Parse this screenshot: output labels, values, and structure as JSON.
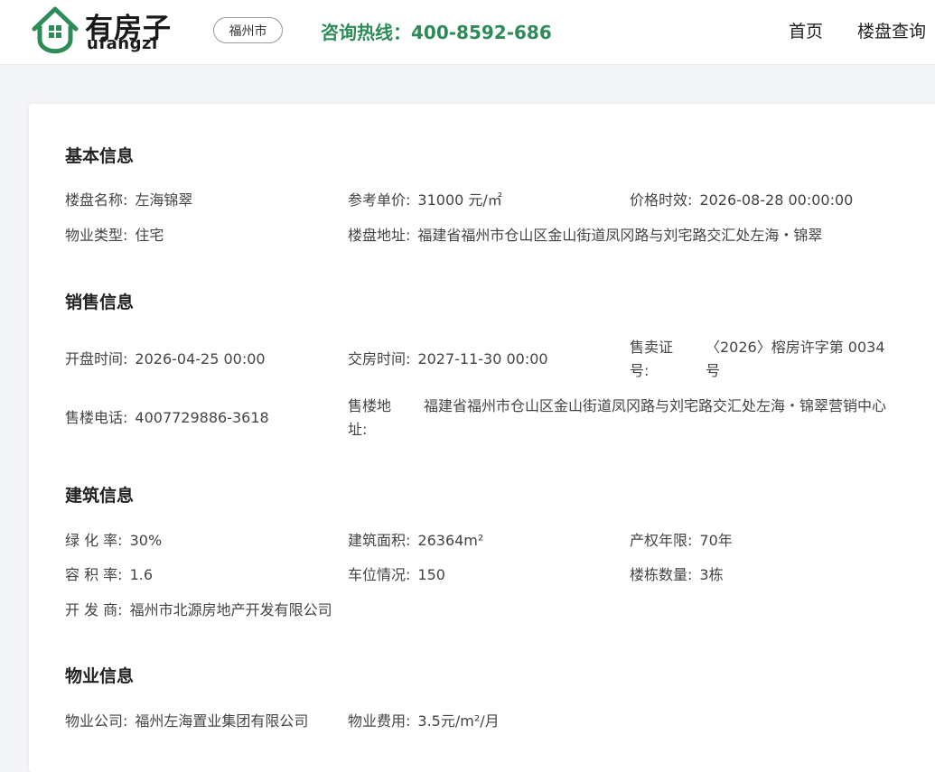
{
  "header": {
    "logo_cn": "有房子",
    "logo_en": "ufangzi",
    "city": "福州市",
    "hotline": "咨询热线：400-8592-686",
    "nav": [
      "首页",
      "楼盘查询"
    ]
  },
  "colors": {
    "brand_green": "#2e8b57",
    "text": "#444444"
  },
  "basic": {
    "title": "基本信息",
    "name_label": "楼盘名称:",
    "name": "左海锦翠",
    "price_label": "参考单价:",
    "price": "31000 元/㎡",
    "price_time_label": "价格时效:",
    "price_time": "2026-08-28 00:00:00",
    "type_label": "物业类型:",
    "type": "住宅",
    "address_label": "楼盘地址:",
    "address": "福建省福州市仓山区金山街道凤冈路与刘宅路交汇处左海・锦翠"
  },
  "sales": {
    "title": "销售信息",
    "open_label": "开盘时间:",
    "open": "2026-04-25 00:00",
    "delivery_label": "交房时间:",
    "delivery": "2027-11-30 00:00",
    "license_label": "售卖证号:",
    "license": "〈2026〉榕房许字第 0034 号",
    "phone_label": "售楼电话:",
    "phone": "4007729886-3618",
    "office_label": "售楼地址:",
    "office": "福建省福州市仓山区金山街道凤冈路与刘宅路交汇处左海・锦翠营销中心"
  },
  "building": {
    "title": "建筑信息",
    "green_label": "绿 化 率:",
    "green": "30%",
    "area_label": "建筑面积:",
    "area": "26364m²",
    "term_label": "产权年限:",
    "term": "70年",
    "plot_label": "容 积 率:",
    "plot": "1.6",
    "parking_label": "车位情况:",
    "parking": "150",
    "count_label": "楼栋数量:",
    "count": "3栋",
    "dev_label": "开 发 商:",
    "dev": "福州市北源房地产开发有限公司"
  },
  "property": {
    "title": "物业信息",
    "company_label": "物业公司:",
    "company": "福州左海置业集团有限公司",
    "fee_label": "物业费用:",
    "fee": "3.5元/m²/月"
  }
}
